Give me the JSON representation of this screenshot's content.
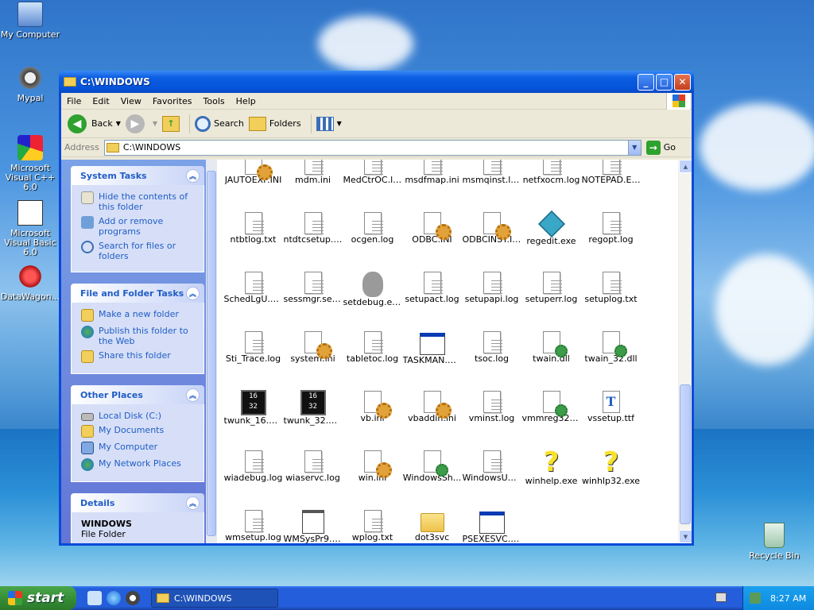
{
  "desktop": {
    "icons": [
      {
        "label": "My Computer",
        "icon": "my-computer-icon"
      },
      {
        "label": "Mypal",
        "icon": "raccoon-browser-icon"
      },
      {
        "label": "Microsoft Visual C++ 6.0",
        "icon": "visual-cpp-icon"
      },
      {
        "label": "Microsoft Visual Basic 6.0",
        "icon": "visual-basic-icon"
      },
      {
        "label": "DataWagon...",
        "icon": "datawagon-icon"
      },
      {
        "label": "Recycle Bin",
        "icon": "recycle-bin-icon"
      }
    ]
  },
  "window": {
    "title": "C:\\WINDOWS",
    "menu": [
      "File",
      "Edit",
      "View",
      "Favorites",
      "Tools",
      "Help"
    ],
    "toolbar": {
      "back": "Back",
      "search": "Search",
      "folders": "Folders"
    },
    "address": {
      "label": "Address",
      "value": "C:\\WINDOWS",
      "go": "Go"
    }
  },
  "taskpane": {
    "system_tasks": {
      "title": "System Tasks",
      "items": [
        "Hide the contents of this folder",
        "Add or remove programs",
        "Search for files or folders"
      ]
    },
    "file_folder_tasks": {
      "title": "File and Folder Tasks",
      "items": [
        "Make a new folder",
        "Publish this folder to the Web",
        "Share this folder"
      ]
    },
    "other_places": {
      "title": "Other Places",
      "items": [
        "Local Disk (C:)",
        "My Documents",
        "My Computer",
        "My Network Places"
      ]
    },
    "details": {
      "title": "Details",
      "name": "WINDOWS",
      "type": "File Folder"
    }
  },
  "files": [
    {
      "name": "JAUTOEXP.INI",
      "type": "ini"
    },
    {
      "name": "mdm.ini",
      "type": "txt"
    },
    {
      "name": "MedCtrOC.log",
      "type": "txt"
    },
    {
      "name": "msdfmap.ini",
      "type": "txt"
    },
    {
      "name": "msmqinst.log",
      "type": "txt"
    },
    {
      "name": "netfxocm.log",
      "type": "txt"
    },
    {
      "name": "NOTEPAD.EXE",
      "type": "txt"
    },
    {
      "name": "ntbtlog.txt",
      "type": "txt"
    },
    {
      "name": "ntdtcsetup.log",
      "type": "txt"
    },
    {
      "name": "ocgen.log",
      "type": "txt"
    },
    {
      "name": "ODBC.INI",
      "type": "ini"
    },
    {
      "name": "ODBCINST.INI",
      "type": "ini"
    },
    {
      "name": "regedit.exe",
      "type": "reg"
    },
    {
      "name": "regopt.log",
      "type": "txt"
    },
    {
      "name": "SchedLgU.Txt",
      "type": "txt"
    },
    {
      "name": "sessmgr.set...",
      "type": "txt"
    },
    {
      "name": "setdebug.exe",
      "type": "bear"
    },
    {
      "name": "setupact.log",
      "type": "txt"
    },
    {
      "name": "setupapi.log",
      "type": "txt"
    },
    {
      "name": "setuperr.log",
      "type": "txt"
    },
    {
      "name": "setuplog.txt",
      "type": "txt"
    },
    {
      "name": "Sti_Trace.log",
      "type": "txt"
    },
    {
      "name": "system.ini",
      "type": "ini"
    },
    {
      "name": "tabletoc.log",
      "type": "txt"
    },
    {
      "name": "TASKMAN.EXE",
      "type": "exe"
    },
    {
      "name": "tsoc.log",
      "type": "txt"
    },
    {
      "name": "twain.dll",
      "type": "dll"
    },
    {
      "name": "twain_32.dll",
      "type": "dll"
    },
    {
      "name": "twunk_16.exe",
      "type": "1632",
      "glyph": "16\n32"
    },
    {
      "name": "twunk_32.exe",
      "type": "1632",
      "glyph": "16\n32"
    },
    {
      "name": "vb.ini",
      "type": "ini"
    },
    {
      "name": "vbaddin.ini",
      "type": "ini"
    },
    {
      "name": "vminst.log",
      "type": "txt"
    },
    {
      "name": "vmmreg32.dll",
      "type": "dll"
    },
    {
      "name": "vssetup.ttf",
      "type": "ttf",
      "glyph": "T"
    },
    {
      "name": "wiadebug.log",
      "type": "txt"
    },
    {
      "name": "wiaservc.log",
      "type": "txt"
    },
    {
      "name": "win.ini",
      "type": "ini"
    },
    {
      "name": "WindowsSh...",
      "type": "dll"
    },
    {
      "name": "WindowsUp...",
      "type": "txt"
    },
    {
      "name": "winhelp.exe",
      "type": "help",
      "glyph": "?"
    },
    {
      "name": "winhlp32.exe",
      "type": "help",
      "glyph": "?"
    },
    {
      "name": "wmsetup.log",
      "type": "txt"
    },
    {
      "name": "WMSysPr9.prx",
      "type": "prx"
    },
    {
      "name": "wplog.txt",
      "type": "txt"
    },
    {
      "name": "dot3svc",
      "type": "folder"
    },
    {
      "name": "PSEXESVC.exe",
      "type": "exe"
    }
  ],
  "taskbar": {
    "start": "start",
    "task": "C:\\WINDOWS",
    "clock": "8:27 AM"
  }
}
